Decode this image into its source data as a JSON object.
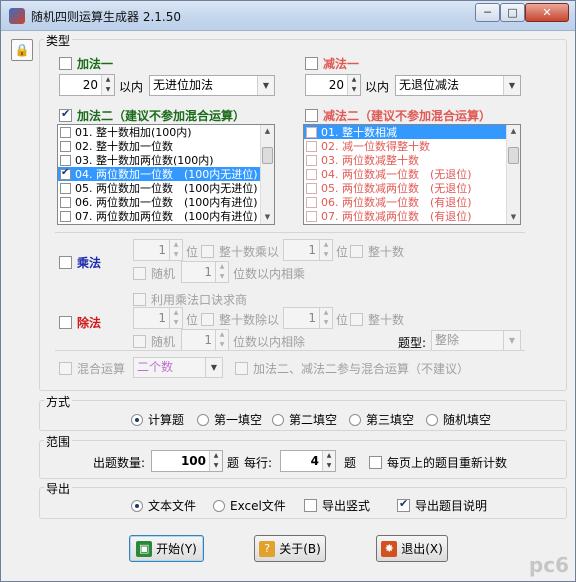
{
  "window": {
    "title": "随机四则运算生成器 2.1.50"
  },
  "type_group": {
    "title": "类型",
    "add1": {
      "label": "加法一",
      "checked": false,
      "spin_value": "20",
      "within": "以内",
      "mode": "无进位加法"
    },
    "sub1": {
      "label": "减法一",
      "checked": false,
      "spin_value": "20",
      "within": "以内",
      "mode": "无退位减法"
    },
    "add2": {
      "label": "加法二（建议不参加混合运算）",
      "checked": true,
      "items": [
        {
          "text": "01. 整十数相加(100内)",
          "checked": false,
          "selected": false
        },
        {
          "text": "02. 整十数加一位数",
          "checked": false,
          "selected": false
        },
        {
          "text": "03. 整十数加两位数(100内)",
          "checked": false,
          "selected": false
        },
        {
          "text": "04. 两位数加一位数　(100内无进位)",
          "checked": true,
          "selected": true
        },
        {
          "text": "05. 两位数加一位数　(100内无进位)",
          "checked": false,
          "selected": false
        },
        {
          "text": "06. 两位数加一位数　(100内有进位)",
          "checked": false,
          "selected": false
        },
        {
          "text": "07. 两位数加两位数　(100内有进位)",
          "checked": false,
          "selected": false
        }
      ]
    },
    "sub2": {
      "label": "减法二（建议不参加混合运算）",
      "checked": false,
      "items": [
        {
          "text": "01. 整十数相减",
          "checked": false,
          "selected": true
        },
        {
          "text": "02. 减一位数得整十数",
          "checked": false,
          "selected": false
        },
        {
          "text": "03. 两位数减整十数",
          "checked": false,
          "selected": false
        },
        {
          "text": "04. 两位数减一位数　(无退位)",
          "checked": false,
          "selected": false
        },
        {
          "text": "05. 两位数减两位数　(无退位)",
          "checked": false,
          "selected": false
        },
        {
          "text": "06. 两位数减一位数　(有退位)",
          "checked": false,
          "selected": false
        },
        {
          "text": "07. 两位数减两位数　(有退位)",
          "checked": false,
          "selected": false
        }
      ]
    },
    "mul": {
      "label": "乘法",
      "checked": false,
      "spin1": "1",
      "digit1": "位",
      "whole1": "整十数",
      "times": "乘以",
      "spin2": "1",
      "digit2": "位",
      "whole2": "整十数",
      "random": "随机",
      "spin3": "1",
      "within_mul": "位数以内相乘"
    },
    "div": {
      "label": "除法",
      "checked": false,
      "use_table": "利用乘法口诀求商",
      "spin1": "1",
      "digit1": "位",
      "whole1": "整十数",
      "divide": "除以",
      "spin2": "1",
      "digit2": "位",
      "whole2": "整十数",
      "random": "随机",
      "spin3": "1",
      "within_div": "位数以内相除",
      "type_label": "题型:",
      "type_value": "整除"
    },
    "mixed": {
      "label": "混合运算",
      "checked": false,
      "value": "二个数",
      "note": "加法二、减法二参与混合运算（不建议）"
    }
  },
  "mode_group": {
    "title": "方式",
    "options": [
      {
        "label": "计算题",
        "on": true
      },
      {
        "label": "第一填空",
        "on": false
      },
      {
        "label": "第二填空",
        "on": false
      },
      {
        "label": "第三填空",
        "on": false
      },
      {
        "label": "随机填空",
        "on": false
      }
    ]
  },
  "range_group": {
    "title": "范围",
    "count_label": "出题数量:",
    "count": "100",
    "count_unit": "题",
    "per_row_label": "每行:",
    "per_row": "4",
    "per_row_unit": "题",
    "recount": "每页上的题目重新计数"
  },
  "export_group": {
    "title": "导出",
    "text_file": "文本文件",
    "excel_file": "Excel文件",
    "vertical": "导出竖式",
    "explain": "导出题目说明"
  },
  "buttons": {
    "start": "开始(Y)",
    "about": "关于(B)",
    "exit": "退出(X)"
  },
  "colors": {
    "add_label": "#1a6b1a",
    "sub_label": "#e05a55",
    "mul_label": "#1a2bb0",
    "div_label": "#d01818",
    "selection": "#3399ff"
  },
  "watermark": "pc6"
}
